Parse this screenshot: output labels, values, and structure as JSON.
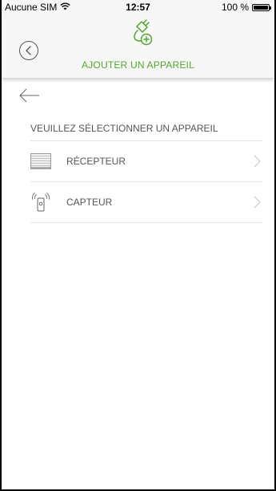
{
  "status_bar": {
    "carrier": "Aucune SIM",
    "time": "12:57",
    "battery": "100 %",
    "icons": [
      "wifi-icon",
      "battery-icon"
    ]
  },
  "header": {
    "title": "AJOUTER UN APPAREIL",
    "back_icon": "circle-back-icon",
    "device_icon": "plug-add-icon"
  },
  "colors": {
    "accent": "#4fa82a",
    "header_bg": "#f7f7f7",
    "text": "#555555"
  },
  "main": {
    "back_icon": "arrow-left-icon",
    "section_label": "VEUILLEZ SÉLECTIONNER UN APPAREIL",
    "items": [
      {
        "label": "RÉCEPTEUR",
        "icon": "blind-receiver-icon"
      },
      {
        "label": "CAPTEUR",
        "icon": "sensor-remote-icon"
      }
    ]
  }
}
